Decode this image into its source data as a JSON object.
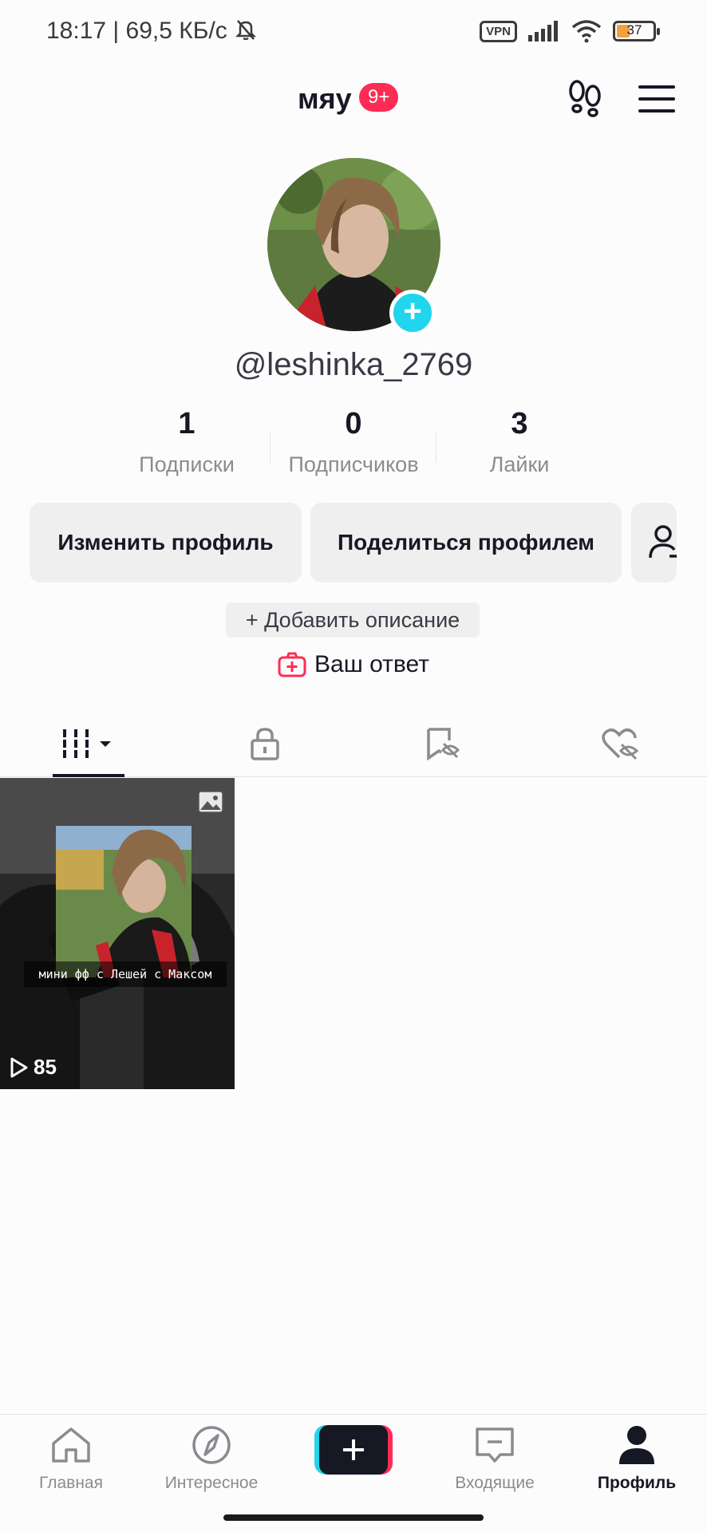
{
  "status_bar": {
    "time_text": "18:17 | 69,5 КБ/с",
    "vpn_label": "VPN",
    "battery_level": "37"
  },
  "header": {
    "title": "мяу",
    "notification_badge": "9+"
  },
  "profile": {
    "handle": "@leshinka_2769",
    "stats": [
      {
        "value": "1",
        "label": "Подписки"
      },
      {
        "value": "0",
        "label": "Подписчиков"
      },
      {
        "value": "3",
        "label": "Лайки"
      }
    ],
    "edit_button": "Изменить профиль",
    "share_button": "Поделиться профилем",
    "add_description": "+ Добавить описание",
    "your_answer": "Ваш ответ"
  },
  "videos": [
    {
      "caption": "мини фф с Лешей с Максом",
      "views": "85"
    }
  ],
  "bottom_nav": {
    "home": "Главная",
    "explore": "Интересное",
    "inbox": "Входящие",
    "profile": "Профиль"
  },
  "colors": {
    "accent_red": "#fe2c55",
    "accent_cyan": "#20d5ec",
    "text_primary": "#161823",
    "text_secondary": "#8a8b91"
  }
}
